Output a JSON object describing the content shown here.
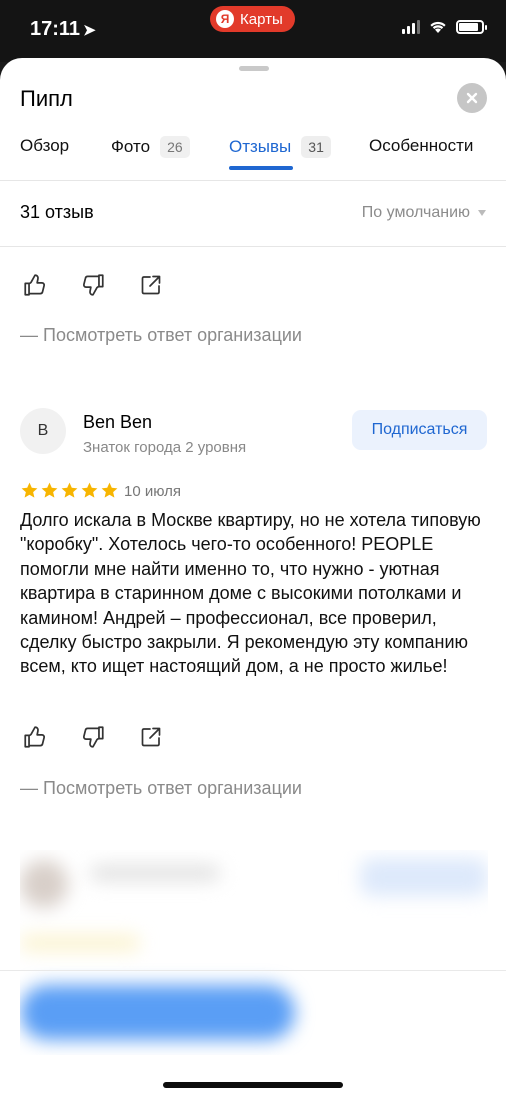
{
  "status_bar": {
    "time": "17:11",
    "location_icon": "location-arrow-icon",
    "app_badge_logo": "Я",
    "app_badge_label": "Карты",
    "battery_level": 0.85
  },
  "header": {
    "title": "Пипл",
    "close_icon": "close-icon"
  },
  "tabs": [
    {
      "label": "Обзор",
      "badge": ""
    },
    {
      "label": "Фото",
      "badge": "26"
    },
    {
      "label": "Отзывы",
      "badge": "31",
      "active": true
    },
    {
      "label": "Особенности",
      "badge": ""
    }
  ],
  "reviews_meta": {
    "count_label": "31 отзыв",
    "sort_label": "По умолчанию"
  },
  "previous_review": {
    "reply_link": "— Посмотреть ответ организации"
  },
  "review": {
    "avatar_letter": "B",
    "author": "Ben Ben",
    "author_level": "Знаток города 2 уровня",
    "subscribe_label": "Подписаться",
    "rating": 5,
    "date": "10 июля",
    "text": "Долго искала в Москве квартиру,  но не хотела типовую \"коробку\".  Хотелось чего-то особенного! PEOPLE  помогли мне найти  именно  то,  что нужно -  уютная  квартира  в  старинном  доме  с высокими  потолками  и  камином!  Андрей – профессионал, все проверил, сделку быстро закрыли.  Я рекомендую эту компанию всем, кто ищет настоящий дом, а не просто жилье!",
    "reply_link": "— Посмотреть ответ организации"
  },
  "colors": {
    "accent": "#1f67d1",
    "star": "#f7b500",
    "status_badge": "#e23a2a"
  }
}
